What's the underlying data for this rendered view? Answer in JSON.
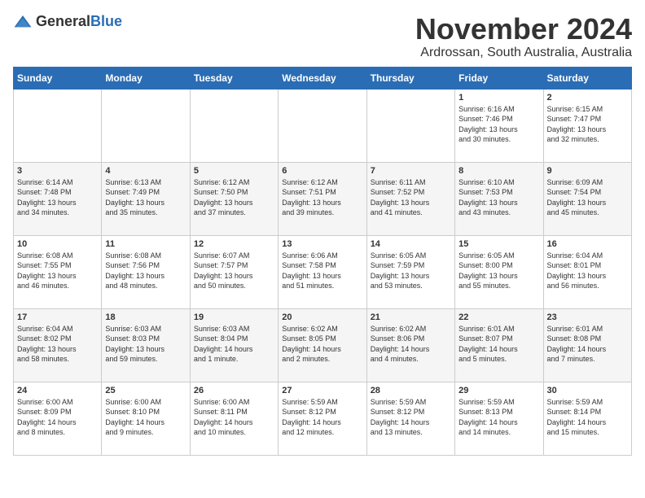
{
  "logo": {
    "text_general": "General",
    "text_blue": "Blue"
  },
  "header": {
    "month": "November 2024",
    "location": "Ardrossan, South Australia, Australia"
  },
  "weekdays": [
    "Sunday",
    "Monday",
    "Tuesday",
    "Wednesday",
    "Thursday",
    "Friday",
    "Saturday"
  ],
  "weeks": [
    [
      {
        "day": "",
        "info": ""
      },
      {
        "day": "",
        "info": ""
      },
      {
        "day": "",
        "info": ""
      },
      {
        "day": "",
        "info": ""
      },
      {
        "day": "",
        "info": ""
      },
      {
        "day": "1",
        "info": "Sunrise: 6:16 AM\nSunset: 7:46 PM\nDaylight: 13 hours\nand 30 minutes."
      },
      {
        "day": "2",
        "info": "Sunrise: 6:15 AM\nSunset: 7:47 PM\nDaylight: 13 hours\nand 32 minutes."
      }
    ],
    [
      {
        "day": "3",
        "info": "Sunrise: 6:14 AM\nSunset: 7:48 PM\nDaylight: 13 hours\nand 34 minutes."
      },
      {
        "day": "4",
        "info": "Sunrise: 6:13 AM\nSunset: 7:49 PM\nDaylight: 13 hours\nand 35 minutes."
      },
      {
        "day": "5",
        "info": "Sunrise: 6:12 AM\nSunset: 7:50 PM\nDaylight: 13 hours\nand 37 minutes."
      },
      {
        "day": "6",
        "info": "Sunrise: 6:12 AM\nSunset: 7:51 PM\nDaylight: 13 hours\nand 39 minutes."
      },
      {
        "day": "7",
        "info": "Sunrise: 6:11 AM\nSunset: 7:52 PM\nDaylight: 13 hours\nand 41 minutes."
      },
      {
        "day": "8",
        "info": "Sunrise: 6:10 AM\nSunset: 7:53 PM\nDaylight: 13 hours\nand 43 minutes."
      },
      {
        "day": "9",
        "info": "Sunrise: 6:09 AM\nSunset: 7:54 PM\nDaylight: 13 hours\nand 45 minutes."
      }
    ],
    [
      {
        "day": "10",
        "info": "Sunrise: 6:08 AM\nSunset: 7:55 PM\nDaylight: 13 hours\nand 46 minutes."
      },
      {
        "day": "11",
        "info": "Sunrise: 6:08 AM\nSunset: 7:56 PM\nDaylight: 13 hours\nand 48 minutes."
      },
      {
        "day": "12",
        "info": "Sunrise: 6:07 AM\nSunset: 7:57 PM\nDaylight: 13 hours\nand 50 minutes."
      },
      {
        "day": "13",
        "info": "Sunrise: 6:06 AM\nSunset: 7:58 PM\nDaylight: 13 hours\nand 51 minutes."
      },
      {
        "day": "14",
        "info": "Sunrise: 6:05 AM\nSunset: 7:59 PM\nDaylight: 13 hours\nand 53 minutes."
      },
      {
        "day": "15",
        "info": "Sunrise: 6:05 AM\nSunset: 8:00 PM\nDaylight: 13 hours\nand 55 minutes."
      },
      {
        "day": "16",
        "info": "Sunrise: 6:04 AM\nSunset: 8:01 PM\nDaylight: 13 hours\nand 56 minutes."
      }
    ],
    [
      {
        "day": "17",
        "info": "Sunrise: 6:04 AM\nSunset: 8:02 PM\nDaylight: 13 hours\nand 58 minutes."
      },
      {
        "day": "18",
        "info": "Sunrise: 6:03 AM\nSunset: 8:03 PM\nDaylight: 13 hours\nand 59 minutes."
      },
      {
        "day": "19",
        "info": "Sunrise: 6:03 AM\nSunset: 8:04 PM\nDaylight: 14 hours\nand 1 minute."
      },
      {
        "day": "20",
        "info": "Sunrise: 6:02 AM\nSunset: 8:05 PM\nDaylight: 14 hours\nand 2 minutes."
      },
      {
        "day": "21",
        "info": "Sunrise: 6:02 AM\nSunset: 8:06 PM\nDaylight: 14 hours\nand 4 minutes."
      },
      {
        "day": "22",
        "info": "Sunrise: 6:01 AM\nSunset: 8:07 PM\nDaylight: 14 hours\nand 5 minutes."
      },
      {
        "day": "23",
        "info": "Sunrise: 6:01 AM\nSunset: 8:08 PM\nDaylight: 14 hours\nand 7 minutes."
      }
    ],
    [
      {
        "day": "24",
        "info": "Sunrise: 6:00 AM\nSunset: 8:09 PM\nDaylight: 14 hours\nand 8 minutes."
      },
      {
        "day": "25",
        "info": "Sunrise: 6:00 AM\nSunset: 8:10 PM\nDaylight: 14 hours\nand 9 minutes."
      },
      {
        "day": "26",
        "info": "Sunrise: 6:00 AM\nSunset: 8:11 PM\nDaylight: 14 hours\nand 10 minutes."
      },
      {
        "day": "27",
        "info": "Sunrise: 5:59 AM\nSunset: 8:12 PM\nDaylight: 14 hours\nand 12 minutes."
      },
      {
        "day": "28",
        "info": "Sunrise: 5:59 AM\nSunset: 8:12 PM\nDaylight: 14 hours\nand 13 minutes."
      },
      {
        "day": "29",
        "info": "Sunrise: 5:59 AM\nSunset: 8:13 PM\nDaylight: 14 hours\nand 14 minutes."
      },
      {
        "day": "30",
        "info": "Sunrise: 5:59 AM\nSunset: 8:14 PM\nDaylight: 14 hours\nand 15 minutes."
      }
    ]
  ]
}
